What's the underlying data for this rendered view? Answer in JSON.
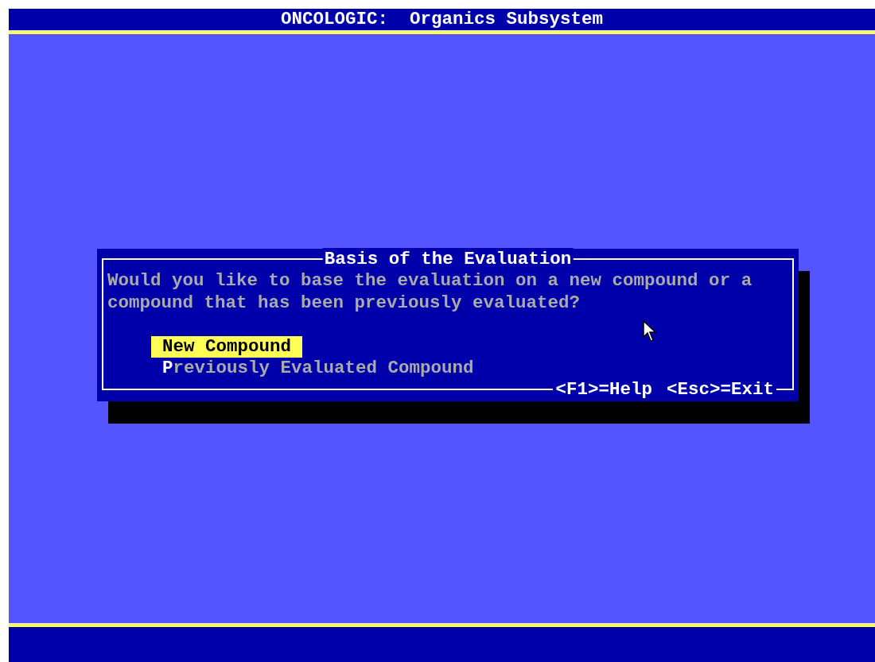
{
  "header": {
    "title": "ONCOLOGIC:  Organics Subsystem"
  },
  "dialog": {
    "title": "Basis of the Evaluation",
    "prompt": "Would you like to base the evaluation on a new compound or a compound that has been previously evaluated?",
    "options": [
      {
        "label": "**N**ew Compound",
        "selected": true
      },
      {
        "label": "**P**reviously Evaluated Compound",
        "selected": false
      }
    ],
    "keys": [
      "<F1>=Help",
      "<Esc>=Exit"
    ]
  }
}
